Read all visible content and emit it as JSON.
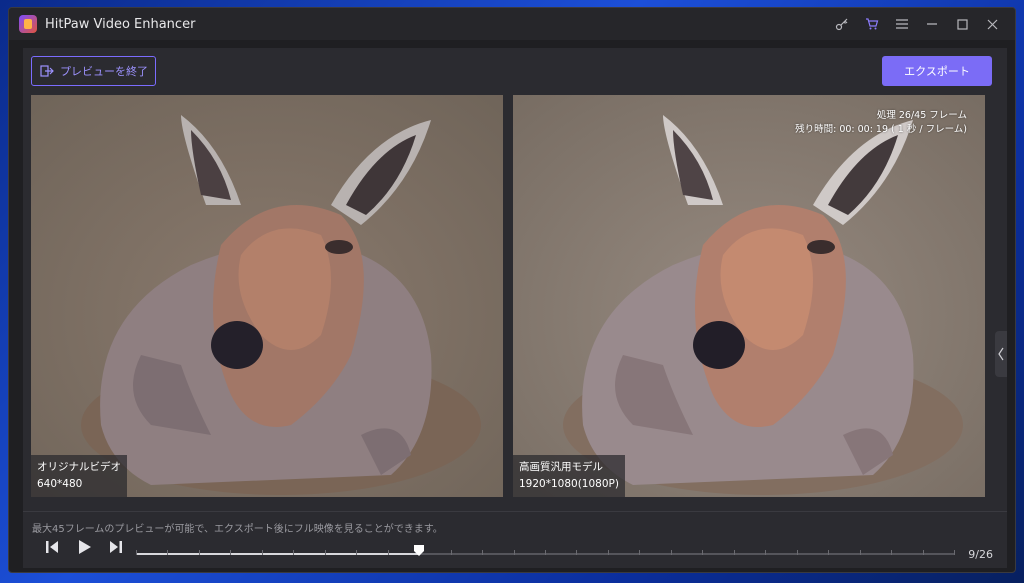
{
  "app": {
    "title": "HitPaw Video Enhancer"
  },
  "titlebar": {
    "icons": [
      "key-icon",
      "cart-icon",
      "menu-icon",
      "minimize-icon",
      "maximize-icon",
      "close-icon"
    ]
  },
  "toolbar": {
    "exit_preview_label": "プレビューを終了",
    "export_label": "エクスポート"
  },
  "left_pane": {
    "label": "オリジナルビデオ",
    "resolution": "640*480"
  },
  "right_pane": {
    "label": "高画質汎用モデル",
    "resolution": "1920*1080(1080P)",
    "progress_line1": "処理 26/45 フレーム",
    "progress_line2": "残り時間: 00: 00: 19 ( 1 秒 / フレーム)"
  },
  "footer": {
    "note": "最大45フレームのプレビューが可能で、エクスポート後にフル映像を見ることができます。",
    "frame_counter": "9/26"
  },
  "playback": {
    "current_frame": 9,
    "total_frames": 26
  },
  "colors": {
    "accent": "#7b6cf6",
    "window_bg": "#1f1f22",
    "panel_bg": "#2b2b30"
  }
}
